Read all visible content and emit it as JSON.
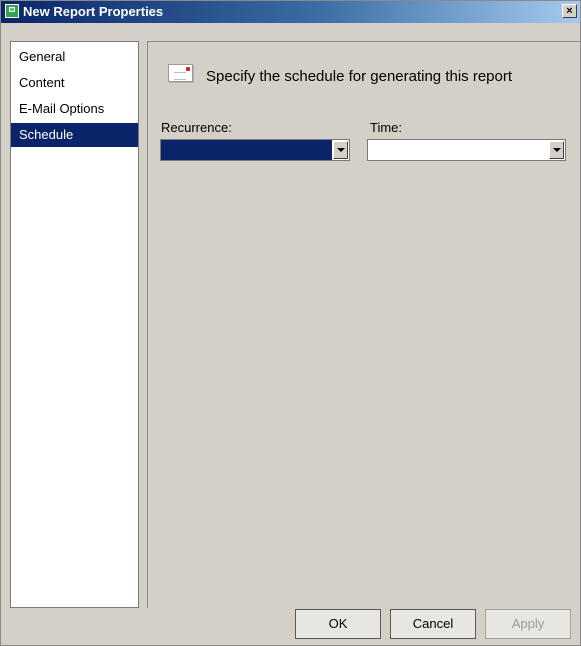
{
  "window": {
    "title": "New Report Properties",
    "close_glyph": "×"
  },
  "nav": {
    "items": [
      {
        "label": "General",
        "selected": false
      },
      {
        "label": "Content",
        "selected": false
      },
      {
        "label": "E-Mail Options",
        "selected": false
      },
      {
        "label": "Schedule",
        "selected": true
      }
    ]
  },
  "schedule": {
    "heading": "Specify the schedule for generating this report",
    "icon": "report-envelope-icon",
    "recurrence": {
      "label": "Recurrence:",
      "value": ""
    },
    "time": {
      "label": "Time:",
      "value": ""
    }
  },
  "buttons": {
    "ok": "OK",
    "cancel": "Cancel",
    "apply": "Apply"
  },
  "colors": {
    "selection": "#0a246a",
    "dialog_bg": "#d4d0c8"
  }
}
